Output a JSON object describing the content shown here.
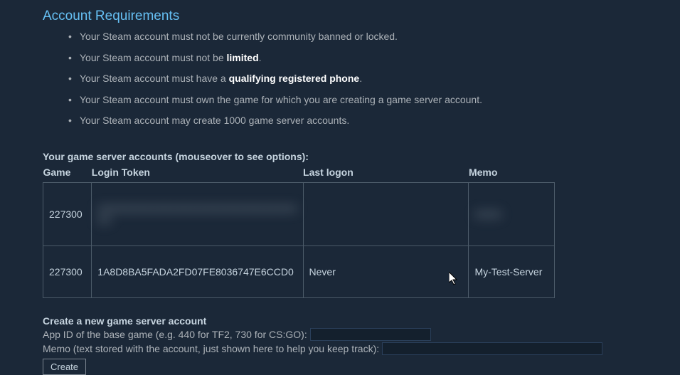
{
  "title": "Account Requirements",
  "requirements": {
    "item1_pre": "Your Steam account must not be currently community banned or locked.",
    "item2_pre": "Your Steam account must not be ",
    "item2_link": "limited",
    "item2_post": ".",
    "item3_pre": "Your Steam account must have a ",
    "item3_link": "qualifying registered phone",
    "item3_post": ".",
    "item4": "Your Steam account must own the game for which you are creating a game server account.",
    "item5": "Your Steam account may create 1000 game server accounts."
  },
  "table": {
    "caption": "Your game server accounts (mouseover to see options):",
    "headers": {
      "game": "Game",
      "token": "Login Token",
      "logon": "Last logon",
      "memo": "Memo"
    },
    "rows": {
      "r1_game": "227300",
      "r1_token": "XXXXXXXXXXXXXXXXXXXXXXXXXXXXXXXX",
      "r1_logon": "",
      "r1_memo": "XXXX",
      "r2_game": "227300",
      "r2_token": "1A8D8BA5FADA2FD07FE8036747E6CCD0",
      "r2_logon": "Never",
      "r2_memo": "My-Test-Server"
    }
  },
  "create": {
    "title": "Create a new game server account",
    "appid_label": "App ID of the base game (e.g. 440 for TF2, 730 for CS:GO): ",
    "memo_label": "Memo (text stored with the account, just shown here to help you keep track): ",
    "button": "Create"
  }
}
